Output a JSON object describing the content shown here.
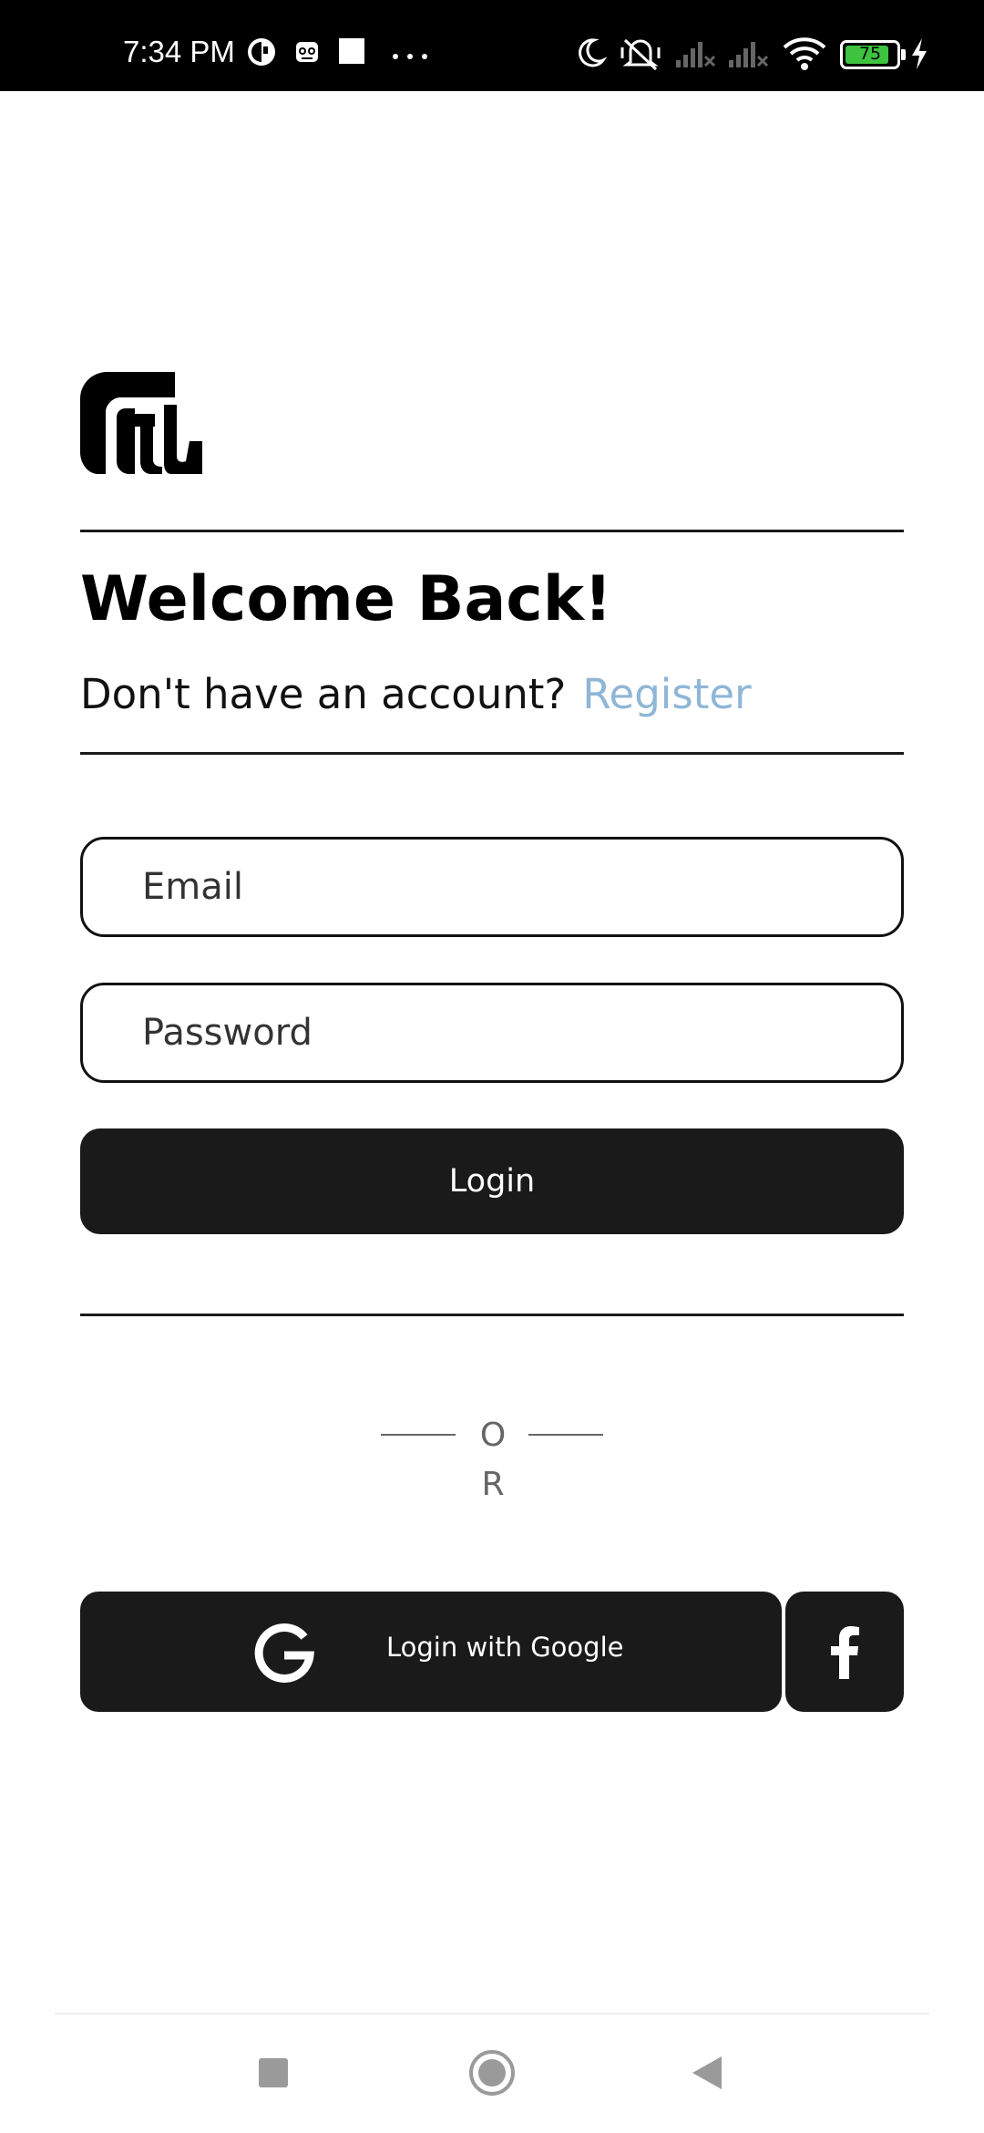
{
  "status_bar": {
    "time": "7:34 PM",
    "battery": "75",
    "icons": [
      "data-saver-icon",
      "robot-icon",
      "square-icon",
      "more-dots-icon",
      "moon-icon",
      "mute-icon",
      "signal-icon",
      "signal-icon",
      "wifi-icon",
      "battery-icon",
      "charging-icon"
    ]
  },
  "header": {
    "title": "Welcome Back!",
    "account_prompt": "Don't have an account?",
    "register_link": "Register"
  },
  "form": {
    "email_placeholder": "Email",
    "password_placeholder": "Password",
    "login_label": "Login"
  },
  "divider": {
    "or_text": "OR"
  },
  "social": {
    "google_label": "Login with Google",
    "google_icon": "google-icon",
    "facebook_icon": "facebook-icon"
  },
  "nav_bar": {
    "icons": [
      "recents-square-icon",
      "home-circle-icon",
      "back-triangle-icon"
    ]
  },
  "colors": {
    "accent_link": "#8fb6d6",
    "button_bg": "#1a1a1a",
    "status_bar_bg": "#000000"
  }
}
